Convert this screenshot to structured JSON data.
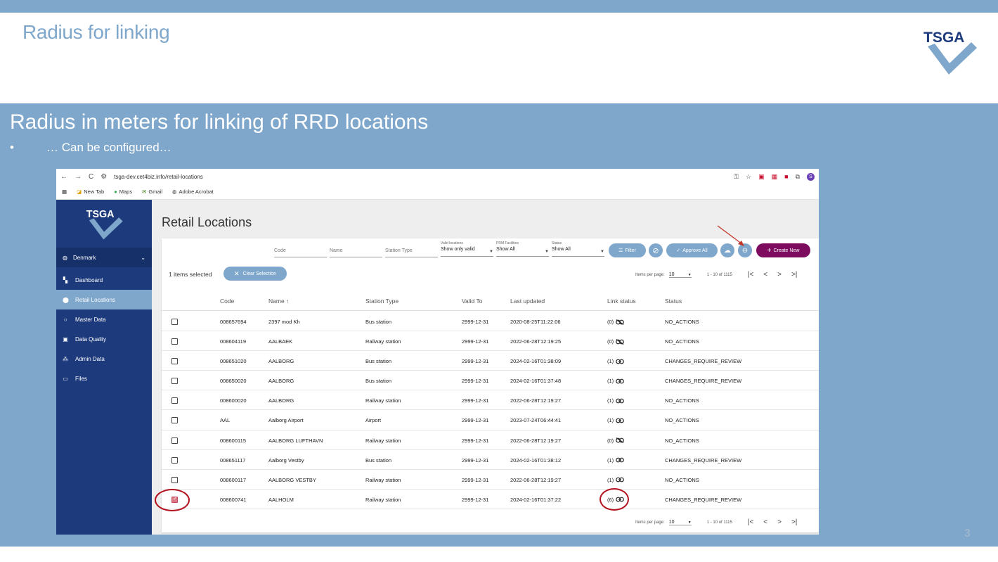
{
  "slide": {
    "title": "Radius for linking",
    "heading": "Radius in meters for linking of RRD locations",
    "bullet_marker": "•",
    "bullet": "… Can be configured…",
    "page_number": "3",
    "logo_text": "TSGA"
  },
  "browser": {
    "url": "tsga-dev.cet4biz.info/retail-locations",
    "bookmarks": [
      "New Tab",
      "Maps",
      "Gmail",
      "Adobe Acrobat"
    ],
    "avatar_letter": "S"
  },
  "sidebar": {
    "logo_text": "TSGA",
    "country": "Denmark",
    "items": [
      {
        "label": "Dashboard",
        "icon": "dashboard-icon"
      },
      {
        "label": "Retail Locations",
        "icon": "location-pin-icon"
      },
      {
        "label": "Master Data",
        "icon": "circle-icon"
      },
      {
        "label": "Data Quality",
        "icon": "quality-icon"
      },
      {
        "label": "Admin Data",
        "icon": "people-icon"
      },
      {
        "label": "Files",
        "icon": "folder-icon"
      }
    ],
    "active_item": "Retail Locations"
  },
  "page": {
    "title": "Retail Locations"
  },
  "filters": {
    "code_placeholder": "Code",
    "name_placeholder": "Name",
    "station_type_placeholder": "Station Type",
    "valid_locations_caption": "Valid locations",
    "valid_locations_value": "Show only valid",
    "prm_caption": "PRM Facilities",
    "prm_value": "Show All",
    "status_caption": "Status",
    "status_value": "Show All"
  },
  "toolbar": {
    "filter_label": "Filter",
    "approve_all_label": "Approve All",
    "create_new_label": "Create New"
  },
  "selection": {
    "count_text": "1 items selected",
    "clear_label": "Clear Selection"
  },
  "pagination": {
    "items_per_page_label": "Items per page:",
    "items_per_page": "10",
    "range": "1 - 10 of 1115"
  },
  "table": {
    "headers": {
      "code": "Code",
      "name": "Name ↑",
      "station_type": "Station Type",
      "valid_to": "Valid To",
      "last_updated": "Last updated",
      "link_status": "Link status",
      "status": "Status"
    },
    "rows": [
      {
        "code": "008657694",
        "name": "2397 mod Kh",
        "station_type": "Bus station",
        "valid_to": "2999-12-31",
        "last_updated": "2020-08-25T11:22:06",
        "link_count": "(0)",
        "linked": false,
        "status": "NO_ACTIONS",
        "checked": false
      },
      {
        "code": "008604119",
        "name": "AALBAEK",
        "station_type": "Railway station",
        "valid_to": "2999-12-31",
        "last_updated": "2022-06-28T12:19:25",
        "link_count": "(0)",
        "linked": false,
        "status": "NO_ACTIONS",
        "checked": false
      },
      {
        "code": "008651020",
        "name": "AALBORG",
        "station_type": "Bus station",
        "valid_to": "2999-12-31",
        "last_updated": "2024-02-16T01:38:09",
        "link_count": "(1)",
        "linked": true,
        "status": "CHANGES_REQUIRE_REVIEW",
        "checked": false
      },
      {
        "code": "008650020",
        "name": "AALBORG",
        "station_type": "Bus station",
        "valid_to": "2999-12-31",
        "last_updated": "2024-02-16T01:37:48",
        "link_count": "(1)",
        "linked": true,
        "status": "CHANGES_REQUIRE_REVIEW",
        "checked": false
      },
      {
        "code": "008600020",
        "name": "AALBORG",
        "station_type": "Railway station",
        "valid_to": "2999-12-31",
        "last_updated": "2022-06-28T12:19:27",
        "link_count": "(1)",
        "linked": true,
        "status": "NO_ACTIONS",
        "checked": false
      },
      {
        "code": "AAL",
        "name": "Aalborg Airport",
        "station_type": "Airport",
        "valid_to": "2999-12-31",
        "last_updated": "2023-07-24T06:44:41",
        "link_count": "(1)",
        "linked": true,
        "status": "NO_ACTIONS",
        "checked": false
      },
      {
        "code": "008600115",
        "name": "AALBORG LUFTHAVN",
        "station_type": "Railway station",
        "valid_to": "2999-12-31",
        "last_updated": "2022-06-28T12:19:27",
        "link_count": "(0)",
        "linked": false,
        "status": "NO_ACTIONS",
        "checked": false
      },
      {
        "code": "008651117",
        "name": "Aalborg Vestby",
        "station_type": "Bus station",
        "valid_to": "2999-12-31",
        "last_updated": "2024-02-16T01:38:12",
        "link_count": "(1)",
        "linked": true,
        "status": "CHANGES_REQUIRE_REVIEW",
        "checked": false
      },
      {
        "code": "008600117",
        "name": "AALBORG VESTBY",
        "station_type": "Railway station",
        "valid_to": "2999-12-31",
        "last_updated": "2022-06-28T12:19:27",
        "link_count": "(1)",
        "linked": true,
        "status": "NO_ACTIONS",
        "checked": false
      },
      {
        "code": "008600741",
        "name": "AALHOLM",
        "station_type": "Railway station",
        "valid_to": "2999-12-31",
        "last_updated": "2024-02-16T01:37:22",
        "link_count": "(6)",
        "linked": true,
        "status": "CHANGES_REQUIRE_REVIEW",
        "checked": true
      }
    ]
  },
  "colors": {
    "slide_blue": "#7ea7cb",
    "sidebar_navy": "#1d3a7c",
    "create_button": "#7d0c5e",
    "highlight_red": "#b3121f"
  }
}
